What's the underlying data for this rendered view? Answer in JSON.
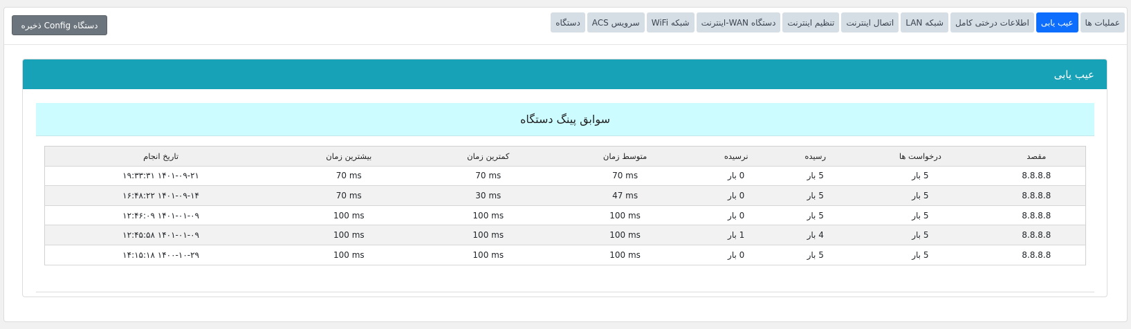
{
  "toolbar": {
    "save_label": "ذخیره Config دستگاه"
  },
  "tabs": [
    {
      "label": "دستگاه",
      "active": false
    },
    {
      "label": "سرویس ACS",
      "active": false
    },
    {
      "label": "شبکه WiFi",
      "active": false
    },
    {
      "label": "دستگاه WAN-اینترنت",
      "active": false
    },
    {
      "label": "تنظیم اینترنت",
      "active": false
    },
    {
      "label": "اتصال اینترنت",
      "active": false
    },
    {
      "label": "شبکه LAN",
      "active": false
    },
    {
      "label": "اطلاعات درختی کامل",
      "active": false
    },
    {
      "label": "عیب یابی",
      "active": true
    },
    {
      "label": "عملیات ها",
      "active": false
    }
  ],
  "card": {
    "title": "عیب یابی",
    "subtitle": "سوابق پینگ دستگاه"
  },
  "table": {
    "headers": [
      "مقصد",
      "درخواست ها",
      "رسیده",
      "نرسیده",
      "متوسط زمان",
      "کمترین زمان",
      "بیشترین زمان",
      "تاریخ انجام"
    ],
    "rows": [
      [
        "8.8.8.8",
        "5 بار",
        "5 بار",
        "0 بار",
        "70 ms",
        "70 ms",
        "70 ms",
        "۱۴۰۱-۰۹-۲۱ ۱۹:۳۳:۳۱"
      ],
      [
        "8.8.8.8",
        "5 بار",
        "5 بار",
        "0 بار",
        "47 ms",
        "30 ms",
        "70 ms",
        "۱۴۰۱-۰۹-۱۴ ۱۶:۴۸:۲۲"
      ],
      [
        "8.8.8.8",
        "5 بار",
        "5 بار",
        "0 بار",
        "100 ms",
        "100 ms",
        "100 ms",
        "۱۴۰۱-۰۱-۰۹ ۱۲:۴۶:۰۹"
      ],
      [
        "8.8.8.8",
        "5 بار",
        "4 بار",
        "1 بار",
        "100 ms",
        "100 ms",
        "100 ms",
        "۱۴۰۱-۰۱-۰۹ ۱۲:۴۵:۵۸"
      ],
      [
        "8.8.8.8",
        "5 بار",
        "5 بار",
        "0 بار",
        "100 ms",
        "100 ms",
        "100 ms",
        "۱۴۰۰-۱۰-۲۹ ۱۴:۱۵:۱۸"
      ]
    ]
  },
  "colors": {
    "header_bg": "#17a2b8",
    "active_tab": "#0d6efd",
    "info_bg": "#ccfcff",
    "save_button": "#6c757d"
  }
}
